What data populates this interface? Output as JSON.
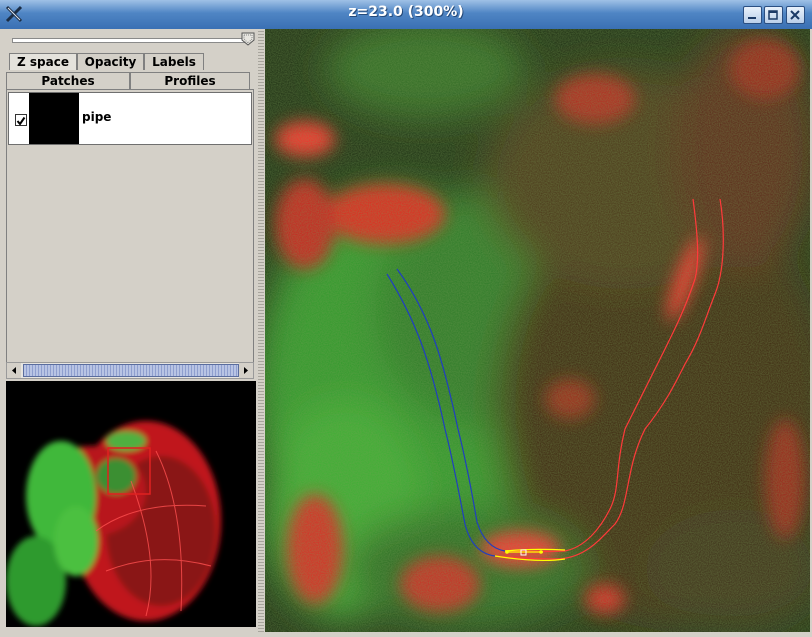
{
  "window": {
    "title": "z=23.0 (300%)",
    "icon": "x-logo-icon"
  },
  "window_controls": {
    "minimize": "minimize-icon",
    "maximize": "maximize-icon",
    "close": "close-icon"
  },
  "tabs_row1": [
    {
      "label": "Z space"
    },
    {
      "label": "Opacity"
    },
    {
      "label": "Labels"
    }
  ],
  "tabs_row2": [
    {
      "label": "Patches"
    },
    {
      "label": "Profiles"
    }
  ],
  "slider": {
    "value": 1.0
  },
  "list": {
    "items": [
      {
        "label": "pipe",
        "checked": true,
        "color": "#000000"
      }
    ]
  },
  "colors": {
    "titlebar": "#4f85c4",
    "panel": "#d4d0c8",
    "pipe_blue": "#1f3fbf",
    "pipe_red": "#ff3a3a",
    "pipe_yellow": "#ffff00"
  }
}
